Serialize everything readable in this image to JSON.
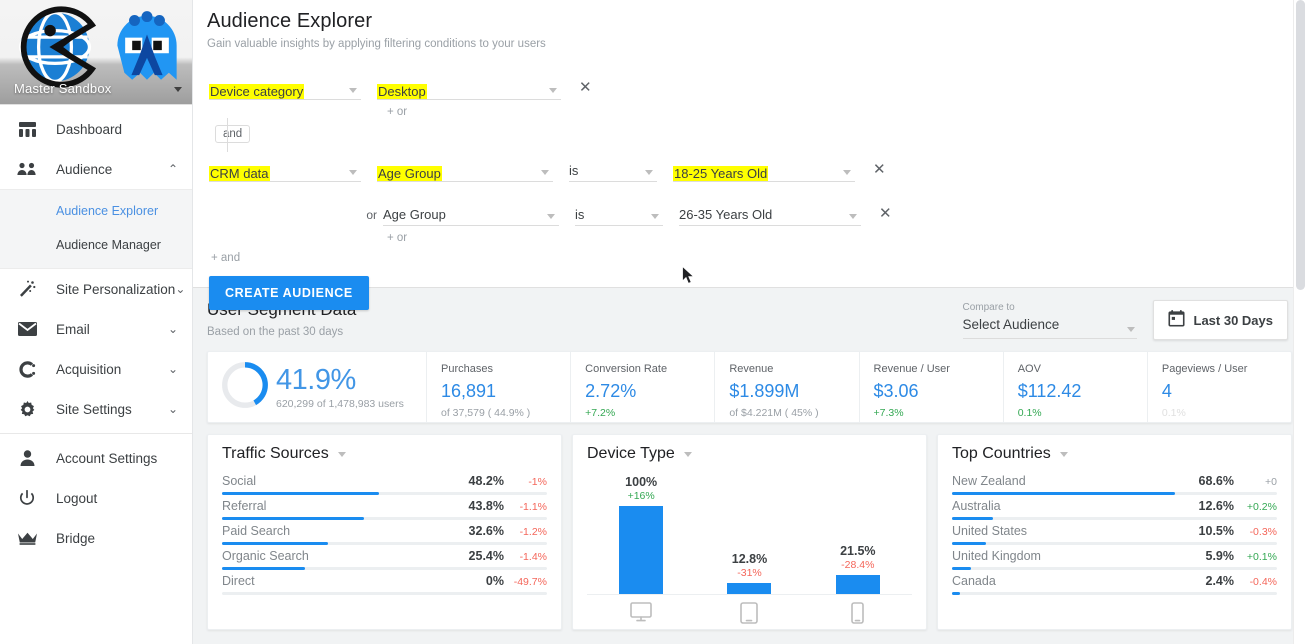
{
  "sidebar": {
    "brand": {
      "name": "Master Sandbox",
      "caret_icon": "caret-down-icon"
    },
    "items": [
      {
        "label": "Dashboard",
        "icon": "dashboard-icon",
        "chevron": ""
      },
      {
        "label": "Audience",
        "icon": "people-icon",
        "chevron": "⌃"
      }
    ],
    "subitems": [
      {
        "label": "Audience Explorer",
        "active": true
      },
      {
        "label": "Audience Manager",
        "active": false
      }
    ],
    "items2": [
      {
        "label": "Site Personalization",
        "icon": "magic-wand-icon",
        "chevron": "⌄"
      },
      {
        "label": "Email",
        "icon": "envelope-icon",
        "chevron": "⌄"
      },
      {
        "label": "Acquisition",
        "icon": "acquisition-c-icon",
        "chevron": "⌄"
      },
      {
        "label": "Site Settings",
        "icon": "gear-icon",
        "chevron": "⌄"
      }
    ],
    "items3": [
      {
        "label": "Account Settings",
        "icon": "person-icon"
      },
      {
        "label": "Logout",
        "icon": "power-icon"
      },
      {
        "label": "Bridge",
        "icon": "crown-icon"
      }
    ]
  },
  "header": {
    "title": "Audience Explorer",
    "subtitle": "Gain valuable insights by applying filtering conditions to your users"
  },
  "builder": {
    "and_chip": "and",
    "add_or_1": "+ or",
    "add_or_2": "+ or",
    "add_and": "+ and",
    "or_label": "or",
    "close_icon": "✕",
    "create_button": "CREATE AUDIENCE",
    "rows": [
      {
        "source": "Device category",
        "value": "Desktop",
        "source_hl": true,
        "value_hl": true
      },
      {
        "source": "CRM data",
        "attribute": "Age Group",
        "operator": "is",
        "value": "18-25 Years Old",
        "source_hl": true,
        "attribute_hl": true,
        "value_hl": true
      },
      {
        "source": "",
        "attribute": "Age Group",
        "operator": "is",
        "value": "26-35 Years Old",
        "source_hl": false,
        "attribute_hl": false,
        "value_hl": false
      }
    ]
  },
  "segment": {
    "title": "User Segment Data",
    "subtitle": "Based on the past 30 days",
    "compare_label": "Compare to",
    "compare_value": "Select Audience",
    "date_button": "Last 30 Days",
    "calendar_icon": "calendar-icon"
  },
  "kpis": {
    "donut": {
      "percent_text": "41.9%",
      "percent_value": 41.9,
      "sub": "620,299 of 1,478,983 users"
    },
    "items": [
      {
        "label": "Purchases",
        "value": "16,891",
        "delta": "of 37,579 ( 44.9% )",
        "delta_kind": "neutral"
      },
      {
        "label": "Conversion Rate",
        "value": "2.72%",
        "delta": "+7.2%",
        "delta_kind": "positive"
      },
      {
        "label": "Revenue",
        "value": "$1.899M",
        "delta": "of $4.221M ( 45% )",
        "delta_kind": "neutral"
      },
      {
        "label": "Revenue / User",
        "value": "$3.06",
        "delta": "+7.3%",
        "delta_kind": "positive"
      },
      {
        "label": "AOV",
        "value": "$112.42",
        "delta": "0.1%",
        "delta_kind": "positive"
      },
      {
        "label": "Pageviews / User",
        "value": "4",
        "delta": "0.1%",
        "delta_kind": "faint"
      }
    ]
  },
  "chart_data": [
    {
      "type": "bar",
      "orientation": "horizontal",
      "title": "Traffic Sources",
      "xlabel": "",
      "ylabel": "",
      "categories": [
        "Social",
        "Referral",
        "Paid Search",
        "Organic Search",
        "Direct"
      ],
      "values": [
        48.2,
        43.8,
        32.6,
        25.4,
        0
      ],
      "value_labels": [
        "48.2%",
        "43.8%",
        "32.6%",
        "25.4%",
        "0%"
      ],
      "deltas": [
        "-1%",
        "-1.1%",
        "-1.2%",
        "-1.4%",
        "-49.7%"
      ],
      "delta_kinds": [
        "negative",
        "negative",
        "negative",
        "negative",
        "negative"
      ],
      "ylim": [
        0,
        100
      ],
      "grid": false,
      "legend": "none"
    },
    {
      "type": "bar",
      "orientation": "vertical",
      "title": "Device Type",
      "xlabel": "",
      "ylabel": "",
      "categories": [
        "Desktop",
        "Tablet",
        "Mobile"
      ],
      "category_icons": [
        "desktop-icon",
        "tablet-icon",
        "mobile-icon"
      ],
      "values": [
        100,
        12.8,
        21.5
      ],
      "value_labels": [
        "100%",
        "12.8%",
        "21.5%"
      ],
      "deltas": [
        "+16%",
        "-31%",
        "-28.4%"
      ],
      "delta_kinds": [
        "positive",
        "negative",
        "negative"
      ],
      "ylim": [
        0,
        100
      ],
      "grid": false,
      "legend": "none"
    },
    {
      "type": "bar",
      "orientation": "horizontal",
      "title": "Top Countries",
      "xlabel": "",
      "ylabel": "",
      "categories": [
        "New Zealand",
        "Australia",
        "United States",
        "United Kingdom",
        "Canada"
      ],
      "values": [
        68.6,
        12.6,
        10.5,
        5.9,
        2.4
      ],
      "value_labels": [
        "68.6%",
        "12.6%",
        "10.5%",
        "5.9%",
        "2.4%"
      ],
      "deltas": [
        "+0",
        "+0.2%",
        "-0.3%",
        "+0.1%",
        "-0.4%"
      ],
      "delta_kinds": [
        "zero",
        "positive",
        "negative",
        "positive",
        "negative"
      ],
      "ylim": [
        0,
        100
      ],
      "grid": false,
      "legend": "none"
    }
  ],
  "colors": {
    "accent_blue": "#1a8cf0",
    "kpi_blue": "#2d8ae5",
    "positive_green": "#34a853",
    "negative_red": "#f4665a",
    "highlight_yellow": "#ffff00",
    "muted_gray": "#9aa0a6"
  }
}
